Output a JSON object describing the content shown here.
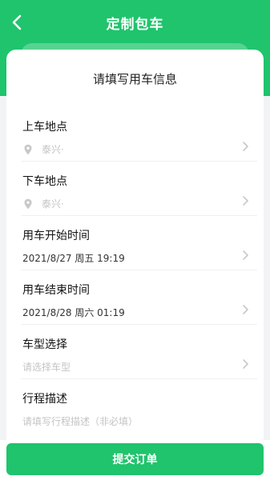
{
  "header": {
    "title": "定制包车"
  },
  "form": {
    "title": "请填写用车信息",
    "rows": [
      {
        "label": "上车地点",
        "value": "泰兴·",
        "icon": "location-pin-icon",
        "is_placeholder": true
      },
      {
        "label": "下车地点",
        "value": "泰兴·",
        "icon": "location-pin-icon",
        "is_placeholder": true
      },
      {
        "label": "用车开始时间",
        "value": "2021/8/27 周五 19:19",
        "is_placeholder": false
      },
      {
        "label": "用车结束时间",
        "value": "2021/8/28 周六 01:19",
        "is_placeholder": false
      },
      {
        "label": "车型选择",
        "value": "请选择车型",
        "is_placeholder": true
      },
      {
        "label": "行程描述",
        "value": "请填写行程描述（非必填）",
        "is_placeholder": true
      }
    ]
  },
  "footer": {
    "submit_label": "提交订单"
  },
  "colors": {
    "accent": "#1fc46c",
    "placeholder": "#c4c4c4"
  }
}
